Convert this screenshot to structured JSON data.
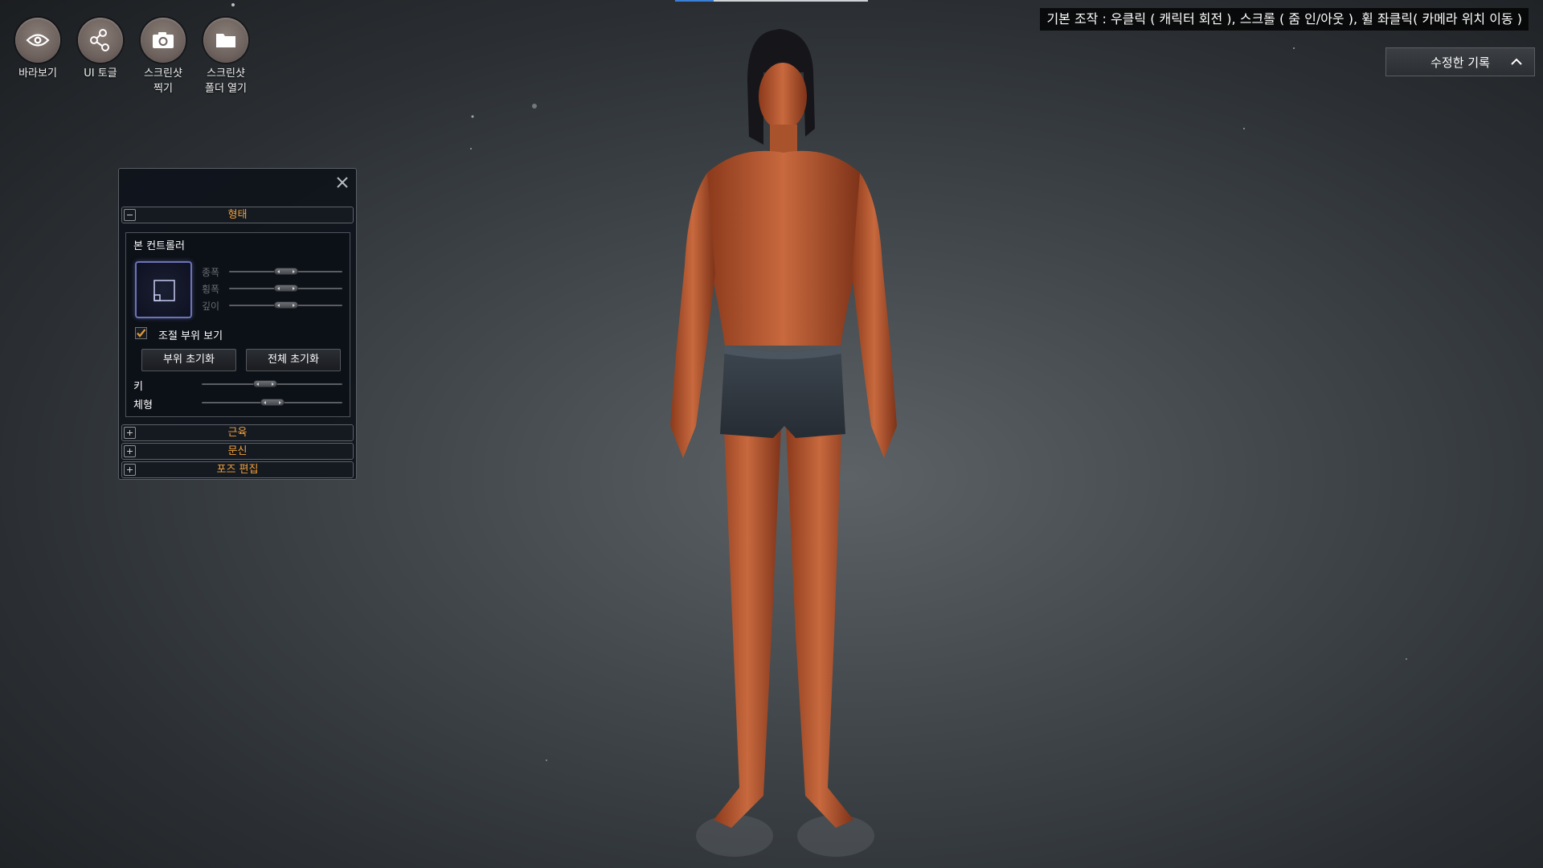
{
  "toolbar": {
    "items": [
      {
        "label": "바라보기",
        "icon": "eye-icon"
      },
      {
        "label": "UI 토글",
        "icon": "ui-toggle-icon"
      },
      {
        "label": "스크린샷\n찍기",
        "icon": "camera-icon"
      },
      {
        "label": "스크린샷\n폴더 열기",
        "icon": "folder-icon"
      }
    ]
  },
  "top_progress": 0.2,
  "hint": "기본 조작 : 우클릭 ( 캐릭터 회전 ), 스크롤 ( 줌 인/아웃 ), 휠 좌클릭( 카메라 위치 이동 )",
  "history": {
    "label": "수정한 기록"
  },
  "panel": {
    "sections": {
      "shape": "형태",
      "muscle": "근육",
      "tattoo": "문신",
      "pose": "포즈 편집"
    },
    "bone_controller": {
      "title": "본 컨트롤러",
      "sliders": [
        {
          "label": "종폭",
          "value": 0.5
        },
        {
          "label": "횡폭",
          "value": 0.5
        },
        {
          "label": "깊이",
          "value": 0.5
        }
      ]
    },
    "show_parts": {
      "label": "조절 부위 보기",
      "checked": true
    },
    "buttons": {
      "reset_part": "부위 초기화",
      "reset_all": "전체 초기화"
    },
    "body_sliders": [
      {
        "label": "키",
        "value": 0.45
      },
      {
        "label": "체형",
        "value": 0.5
      }
    ]
  },
  "colors": {
    "accent": "#f0a03c",
    "progress": "#3b7fd6",
    "bonebox_border": "#6c73b8"
  }
}
